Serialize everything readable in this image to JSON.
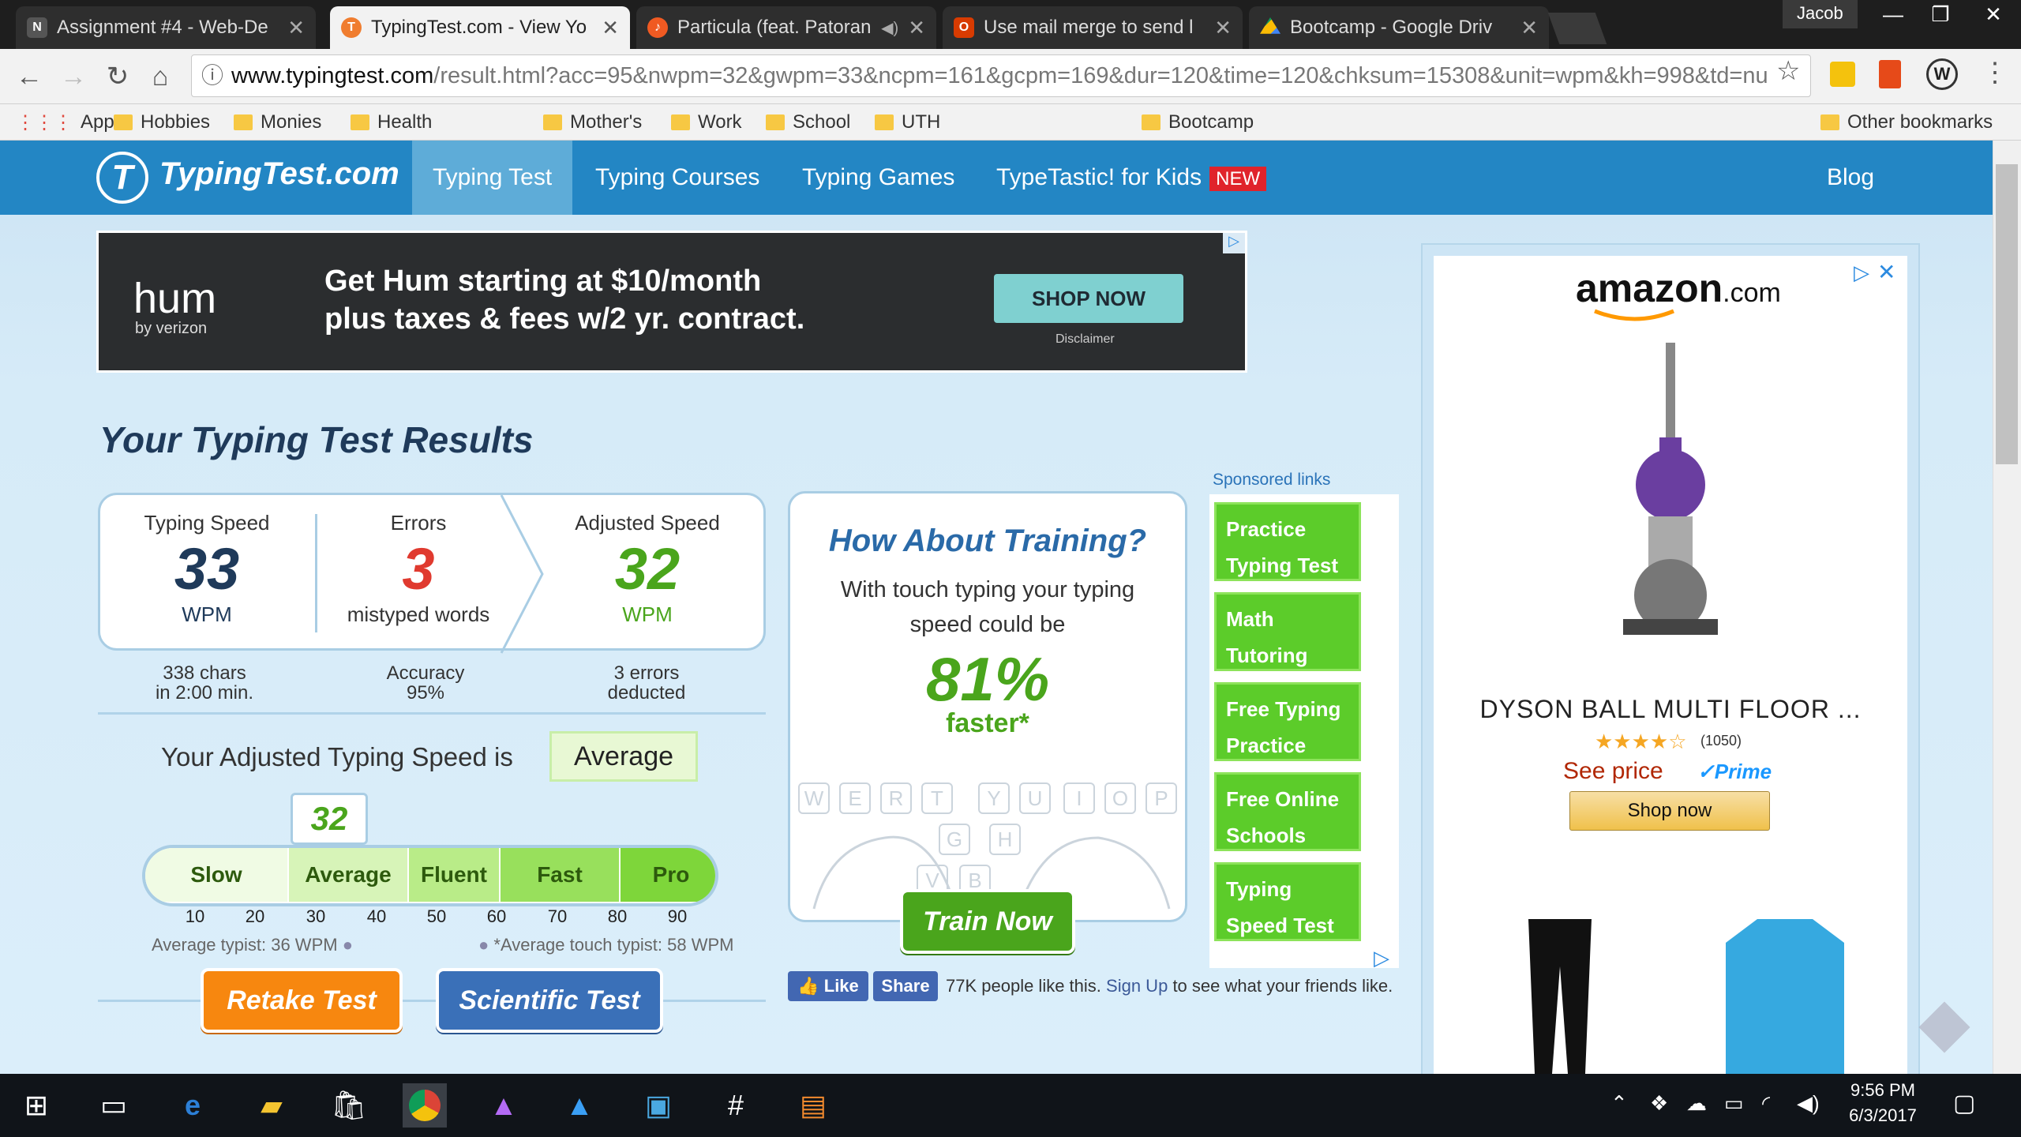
{
  "browser": {
    "tabs": [
      {
        "title": "Assignment #4 - Web-De",
        "icon": "onenote-icon",
        "color": "#444"
      },
      {
        "title": "TypingTest.com - View Yo",
        "icon": "typingtest-icon",
        "color": "#f07d2f"
      },
      {
        "title": "Particula (feat. Patoran",
        "icon": "music-icon",
        "color": "#f05a22"
      },
      {
        "title": "Use mail merge to send l",
        "icon": "office-icon",
        "color": "#d83b01"
      },
      {
        "title": "Bootcamp - Google Driv",
        "icon": "drive-icon",
        "color": "#fbbc05"
      }
    ],
    "user": "Jacob",
    "url_host": "www.typingtest.com",
    "url_rest": "/result.html?acc=95&nwpm=32&gwpm=33&ncpm=161&gcpm=169&dur=120&time=120&chksum=15308&unit=wpm&kh=998&td=nu",
    "bookmarks": [
      "Apps",
      "Hobbies",
      "Monies",
      "Health",
      "Mother's",
      "Work",
      "School",
      "UTH",
      "Bootcamp"
    ],
    "other_bookmarks": "Other bookmarks"
  },
  "site": {
    "logo": "TypingTest.com",
    "nav": [
      "Typing Test",
      "Typing Courses",
      "Typing Games",
      "TypeTastic! for Kids"
    ],
    "new_badge": "NEW",
    "blog": "Blog"
  },
  "ad_top": {
    "brand": "hum",
    "brand_sub": "by verizon",
    "line1": "Get Hum starting at $10/month",
    "line2": "plus taxes & fees w/2 yr. contract.",
    "cta": "SHOP NOW",
    "disclaimer": "Disclaimer"
  },
  "results": {
    "heading": "Your Typing Test Results",
    "typing_speed": {
      "label": "Typing Speed",
      "value": "33",
      "unit": "WPM"
    },
    "errors": {
      "label": "Errors",
      "value": "3",
      "unit": "mistyped words"
    },
    "adjusted": {
      "label": "Adjusted Speed",
      "value": "32",
      "unit": "WPM"
    },
    "chars_line1": "338 chars",
    "chars_line2": "in 2:00 min.",
    "accuracy_line1": "Accuracy",
    "accuracy_line2": "95%",
    "deducted_line1": "3 errors",
    "deducted_line2": "deducted",
    "level_text": "Your Adjusted Typing Speed is",
    "level": "Average",
    "marker": "32",
    "gauge_segments": [
      "Slow",
      "Average",
      "Fluent",
      "Fast",
      "Pro"
    ],
    "ticks": [
      "10",
      "20",
      "30",
      "40",
      "50",
      "60",
      "70",
      "80",
      "90"
    ],
    "avg_typist": "Average typist: 36 WPM",
    "avg_touch": "*Average touch typist: 58 WPM",
    "retake": "Retake Test",
    "scientific": "Scientific Test"
  },
  "training": {
    "title": "How About Training?",
    "text1": "With touch typing your typing",
    "text2": "speed could be",
    "pct": "81%",
    "faster": "faster*",
    "keys": [
      "W",
      "E",
      "R",
      "T",
      "Y",
      "U",
      "I",
      "O",
      "P",
      "G",
      "H",
      "V",
      "B"
    ],
    "cta": "Train Now"
  },
  "fb": {
    "like": "Like",
    "share": "Share",
    "text": "77K people like this.",
    "signup": "Sign Up",
    "rest": "to see what your friends like."
  },
  "sponsored": {
    "heading": "Sponsored links",
    "items": [
      "Practice Typing Test",
      "Math Tutoring Websites",
      "Free Typing Practice",
      "Free Online Schools",
      "Typing Speed Test"
    ]
  },
  "amazon": {
    "logo": "amazon",
    "logo_suffix": ".com",
    "product": "DYSON BALL MULTI FLOOR ...",
    "reviews": "(1050)",
    "see_price": "See price",
    "prime": "Prime",
    "shop": "Shop now"
  },
  "taskbar": {
    "time": "9:56 PM",
    "date": "6/3/2017"
  },
  "colors": {
    "nav": "#2386c4",
    "navy": "#1f3a5a",
    "red": "#e03a2f",
    "green": "#4aa51c",
    "orange": "#f7870f",
    "blue_btn": "#3a70b8"
  }
}
